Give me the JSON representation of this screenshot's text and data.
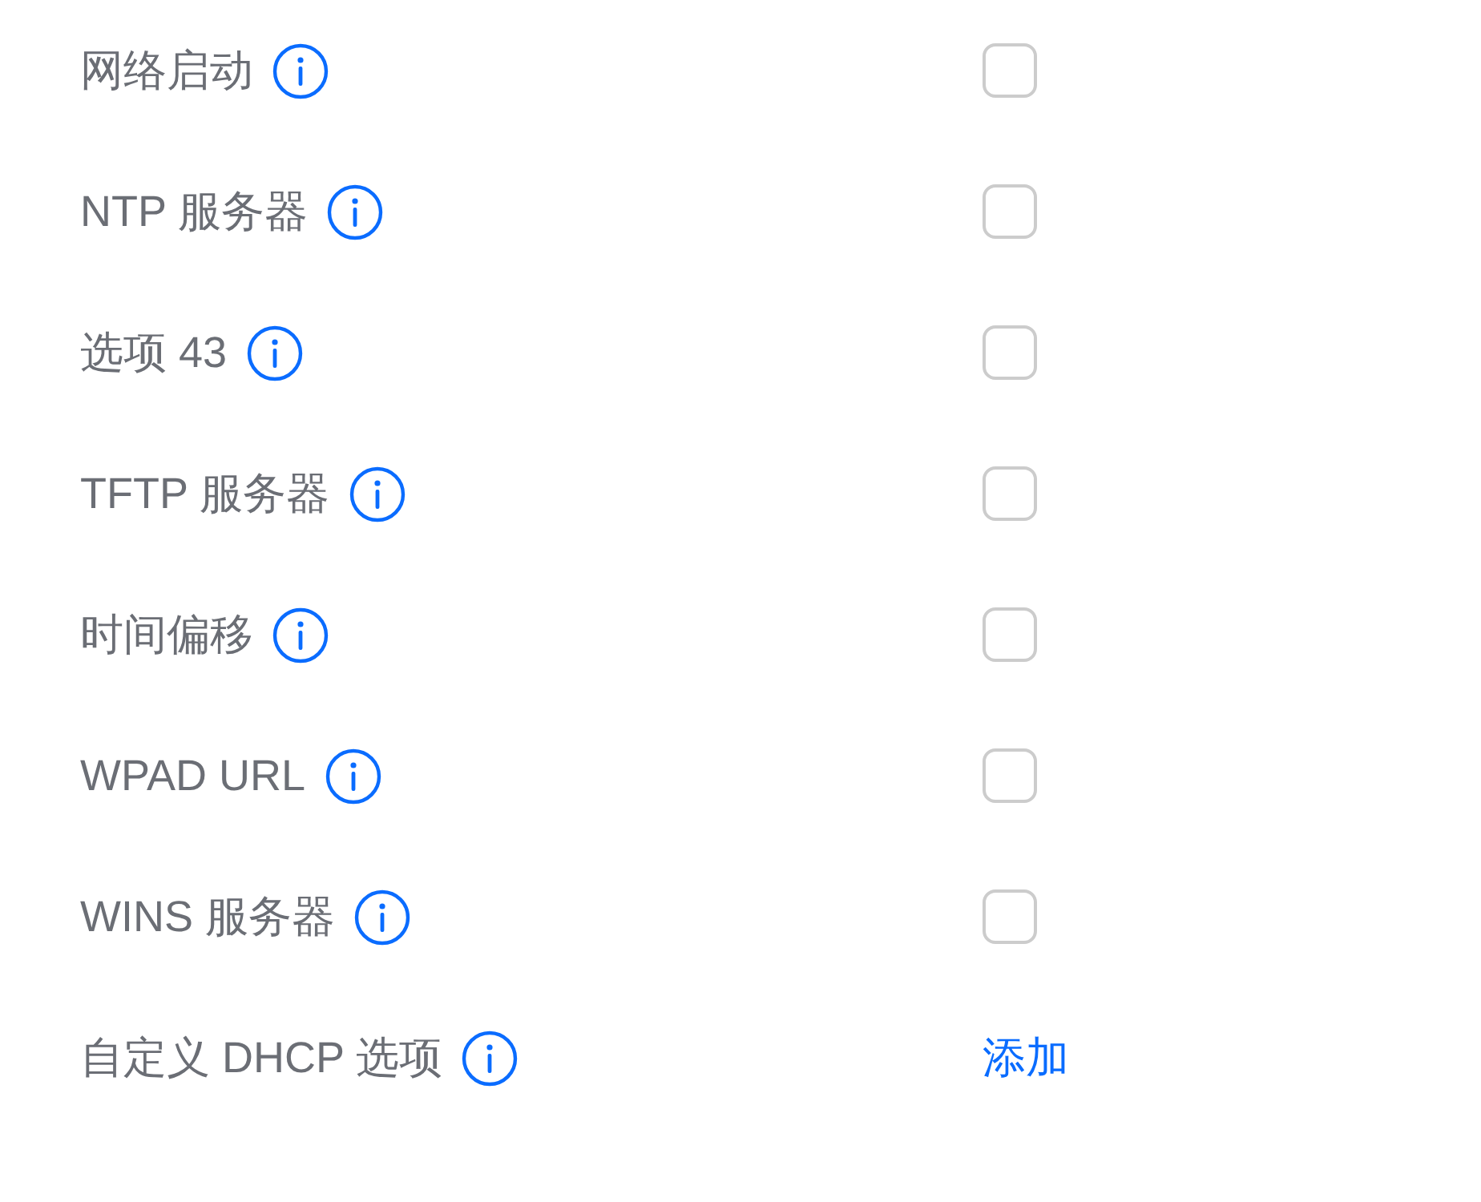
{
  "options": [
    {
      "label": "网络启动",
      "kind": "checkbox",
      "checked": false
    },
    {
      "label": "NTP 服务器",
      "kind": "checkbox",
      "checked": false
    },
    {
      "label": "选项 43",
      "kind": "checkbox",
      "checked": false
    },
    {
      "label": "TFTP 服务器",
      "kind": "checkbox",
      "checked": false
    },
    {
      "label": "时间偏移",
      "kind": "checkbox",
      "checked": false
    },
    {
      "label": "WPAD URL",
      "kind": "checkbox",
      "checked": false
    },
    {
      "label": "WINS 服务器",
      "kind": "checkbox",
      "checked": false
    },
    {
      "label": "自定义 DHCP 选项",
      "kind": "link",
      "action": "添加"
    }
  ]
}
